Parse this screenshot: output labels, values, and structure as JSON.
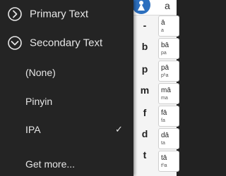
{
  "menu": {
    "sections": [
      {
        "label": "Primary Text",
        "icon": "chevron-right-circle-icon"
      },
      {
        "label": "Secondary Text",
        "icon": "chevron-down-circle-icon"
      }
    ],
    "items": [
      {
        "label": "(None)",
        "checked": false
      },
      {
        "label": "Pinyin",
        "checked": false
      },
      {
        "label": "IPA",
        "checked": true
      },
      {
        "label": "Get more...",
        "checked": false
      }
    ],
    "check_glyph": "✓"
  },
  "background": {
    "top_letter": "a",
    "initials": [
      "-",
      "b",
      "p",
      "m",
      "f",
      "d",
      "t"
    ],
    "cells": [
      {
        "syl": "ā",
        "sub": "a"
      },
      {
        "syl": "bā",
        "sub": "pa"
      },
      {
        "syl": "pā",
        "sub": "pʰa"
      },
      {
        "syl": "mā",
        "sub": "ma"
      },
      {
        "syl": "fā",
        "sub": "fa"
      },
      {
        "syl": "dā",
        "sub": "ta"
      },
      {
        "syl": "tā",
        "sub": "tʰa"
      }
    ]
  },
  "colors": {
    "drawer_bg": "#242424",
    "text": "#e6e6e6",
    "app_bg": "#f4f4f4",
    "app_icon": "#2c6fbe"
  }
}
